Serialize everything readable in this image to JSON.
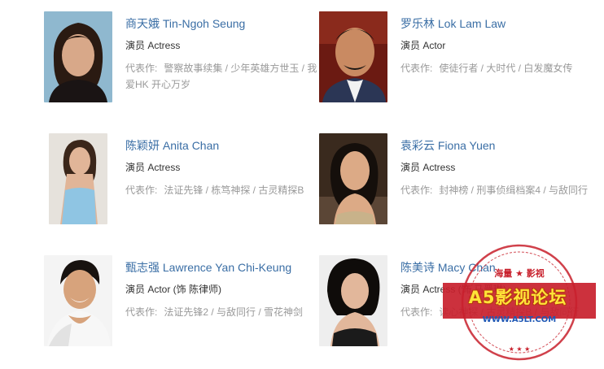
{
  "cast": [
    {
      "name": "商天娥 Tin-Ngoh Seung",
      "role": "演员 Actress",
      "works_label": "代表作:",
      "works": "警察故事续集 / 少年英雄方世玉 / 我爱HK 开心万岁",
      "photo_colors": {
        "bg": "#8fb8cf",
        "skin": "#d8a889",
        "hair": "#2a1a12",
        "cloth": "#1a1414"
      }
    },
    {
      "name": "罗乐林 Lok Lam Law",
      "role": "演员 Actor",
      "works_label": "代表作:",
      "works": "使徒行者 / 大时代 / 白发魔女传",
      "photo_colors": {
        "bg": "#6b1a12",
        "skin": "#c98a62",
        "hair": "#1b1613",
        "cloth": "#f2f2f2"
      }
    },
    {
      "name": "陈颖妍 Anita Chan",
      "role": "演员 Actress",
      "works_label": "代表作:",
      "works": "法证先锋 / 栋笃神探 / 古灵精探B",
      "photo_colors": {
        "bg": "#e6e2dc",
        "skin": "#e1b598",
        "hair": "#3b261a",
        "cloth": "#8fc5e3"
      }
    },
    {
      "name": "袁彩云 Fiona Yuen",
      "role": "演员 Actress",
      "works_label": "代表作:",
      "works": "封神榜 / 刑事侦缉档案4 / 与敌同行",
      "photo_colors": {
        "bg": "#3a2a1e",
        "skin": "#dcaa86",
        "hair": "#150f0b",
        "cloth": "#c8b28a"
      }
    },
    {
      "name": "甄志强 Lawrence Yan Chi-Keung",
      "role": "演员 Actor (饰 陈律师)",
      "works_label": "代表作:",
      "works": "法证先锋2 / 与敌同行 / 雪花神剑",
      "photo_colors": {
        "bg": "#f4f4f4",
        "skin": "#d7a37c",
        "hair": "#17120f",
        "cloth": "#f7f7f7"
      }
    },
    {
      "name": "陈美诗 Macy Chan",
      "role": "演员 Actress (饰 马晋琳)",
      "works_label": "代表作:",
      "works": "读心神探 / 古灵精探B / 与敌同行",
      "photo_colors": {
        "bg": "#eeeeee",
        "skin": "#e2b79b",
        "hair": "#0f0c0a",
        "cloth": "#1b1b1b"
      }
    }
  ],
  "watermark": {
    "top_text": "海量 ★ 影视",
    "brand": "A5影视论坛",
    "url": "WWW.A5LT.COM",
    "color": "#c8202c"
  }
}
